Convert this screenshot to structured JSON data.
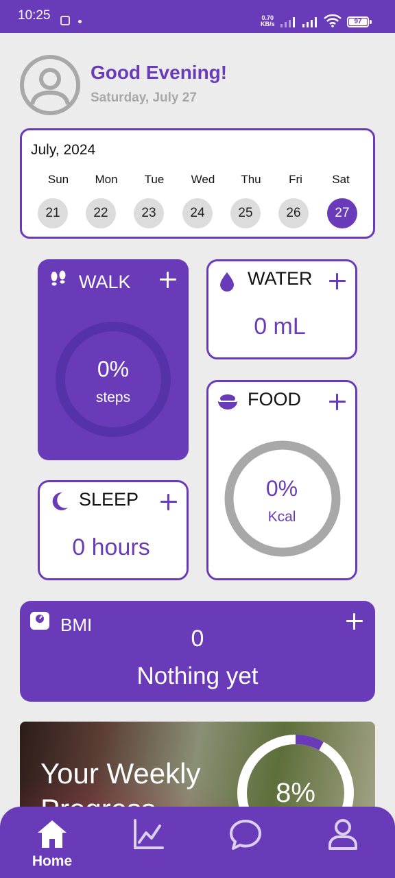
{
  "status_bar": {
    "time": "10:25",
    "net_speed_value": "0.70",
    "net_speed_unit": "KB/s",
    "battery": "97"
  },
  "header": {
    "greeting": "Good Evening!",
    "date": "Saturday, July 27"
  },
  "calendar": {
    "month": "July, 2024",
    "days": [
      {
        "name": "Sun",
        "num": "21"
      },
      {
        "name": "Mon",
        "num": "22"
      },
      {
        "name": "Tue",
        "num": "23"
      },
      {
        "name": "Wed",
        "num": "24"
      },
      {
        "name": "Thu",
        "num": "25"
      },
      {
        "name": "Fri",
        "num": "26"
      },
      {
        "name": "Sat",
        "num": "27"
      }
    ],
    "selected": "27"
  },
  "walk": {
    "title": "WALK",
    "percent": "0%",
    "unit": "steps"
  },
  "water": {
    "title": "WATER",
    "value": "0 mL"
  },
  "food": {
    "title": "FOOD",
    "percent": "0%",
    "unit": "Kcal"
  },
  "sleep": {
    "title": "SLEEP",
    "value": "0 hours"
  },
  "bmi": {
    "title": "BMI",
    "value": "0",
    "status": "Nothing yet"
  },
  "weekly": {
    "title": "Your Weekly Progress",
    "percent": "8%",
    "progress": 0.08
  },
  "nav": [
    {
      "label": "Home",
      "icon": "home-icon",
      "active": true
    },
    {
      "label": "",
      "icon": "chart-icon",
      "active": false
    },
    {
      "label": "",
      "icon": "chat-icon",
      "active": false
    },
    {
      "label": "",
      "icon": "profile-icon",
      "active": false
    }
  ],
  "colors": {
    "accent": "#6a3bb8",
    "background": "#ececec",
    "ring_gray": "#a8a8a8",
    "ring_purple_dark": "#5632a8"
  }
}
